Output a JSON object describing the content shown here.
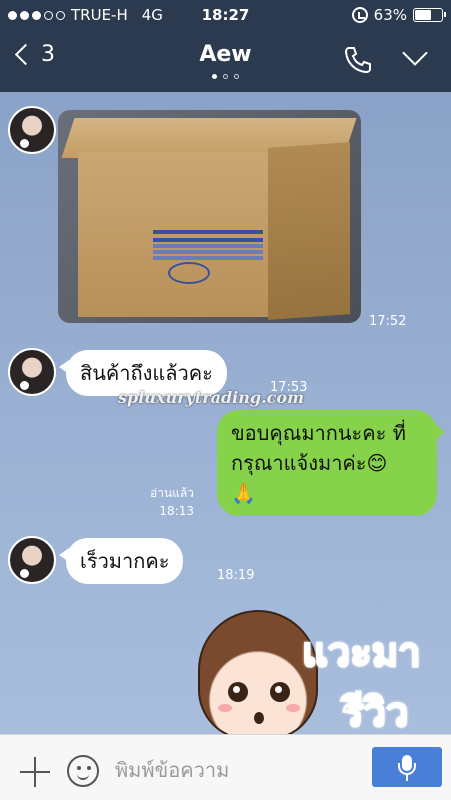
{
  "status_bar": {
    "carrier": "TRUE-H",
    "network": "4G",
    "time": "18:27",
    "battery": "63%",
    "battery_level": 0.63,
    "signal_bars": 3
  },
  "header": {
    "back_count": "3",
    "title": "Aew",
    "page_indicator": {
      "total": 3,
      "active": 1
    }
  },
  "messages": {
    "photo": {
      "time": "17:53",
      "time2": "17:52"
    },
    "m1": {
      "text": "สินค้าถึงแล้วคะ",
      "time": "17:53"
    },
    "m2": {
      "text_line1": "ขอบคุณมากนะคะ ที่",
      "text_line2": "กรุณาแจ้งมาค่ะ😊",
      "text_line3": "🙏",
      "read": "อ่านแล้ว",
      "time": "18:13"
    },
    "m3": {
      "text": "เร็วมากคะ",
      "time": "18:19"
    },
    "sticker": {
      "line1": "แวะมา",
      "line2": "รีวิว"
    }
  },
  "watermark": "spluxurytrading.com",
  "input": {
    "placeholder": "พิมพ์ข้อความ"
  },
  "colors": {
    "header_bg": "#2c3a4f",
    "chat_bg": "#8fa7c9",
    "outgoing_bubble": "#86d24a",
    "incoming_bubble": "#ffffff",
    "mic_button": "#4a7fd8",
    "sticker_text": "#e4147a"
  }
}
